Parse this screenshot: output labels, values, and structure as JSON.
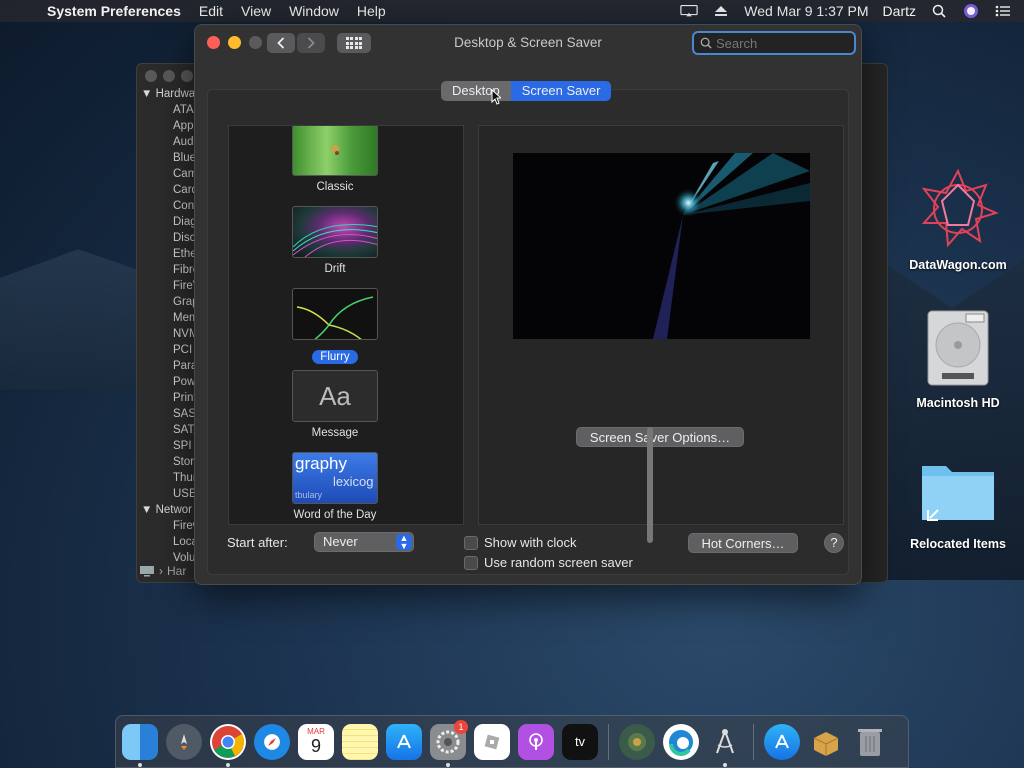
{
  "menubar": {
    "app_name": "System Preferences",
    "menus": [
      "Edit",
      "View",
      "Window",
      "Help"
    ],
    "datetime": "Wed Mar 9  1:37 PM",
    "user": "Dartz"
  },
  "background_window": {
    "tree": {
      "hardware_header": "Hardwa",
      "hardware_items": [
        "ATA",
        "App",
        "Audi",
        "Blue",
        "Cam",
        "Card",
        "Cont",
        "Diag",
        "Disc",
        "Ethe",
        "Fibre",
        "FireV",
        "Grap",
        "Mem",
        "NVM",
        "PCI",
        "Para",
        "Pow",
        "Print",
        "SAS",
        "SATA",
        "SPI",
        "Stor",
        "Thun",
        "USB"
      ],
      "network_header": "Networ",
      "network_items": [
        "Firew",
        "Loca",
        "Volu"
      ]
    },
    "pathbar": "Har"
  },
  "window": {
    "title": "Desktop & Screen Saver",
    "search_placeholder": "Search",
    "tabs": [
      {
        "label": "Desktop",
        "selected": false
      },
      {
        "label": "Screen Saver",
        "selected": true
      }
    ],
    "savers": [
      {
        "label": "Classic",
        "selected": false
      },
      {
        "label": "Drift",
        "selected": false
      },
      {
        "label": "Flurry",
        "selected": true
      },
      {
        "label": "Message",
        "selected": false
      },
      {
        "label": "Word of the Day",
        "selected": false
      }
    ],
    "message_thumb_text": "Aa",
    "word_thumb_text": "graphy",
    "word_thumb_text2": "lexicog",
    "word_thumb_text3": "tbulary",
    "options_button": "Screen Saver Options…",
    "start_after_label": "Start after:",
    "start_after_value": "Never",
    "show_with_clock": "Show with clock",
    "use_random": "Use random screen saver",
    "hot_corners": "Hot Corners…",
    "help": "?"
  },
  "desktop_icons": [
    "DataWagon.com",
    "Macintosh HD",
    "Relocated Items"
  ],
  "dock": {
    "calendar_month": "MAR",
    "calendar_day": "9",
    "badge_count": "1",
    "appletv": "tv"
  },
  "colors": {
    "accent": "#2a6ae4",
    "window_bg": "#323233"
  }
}
